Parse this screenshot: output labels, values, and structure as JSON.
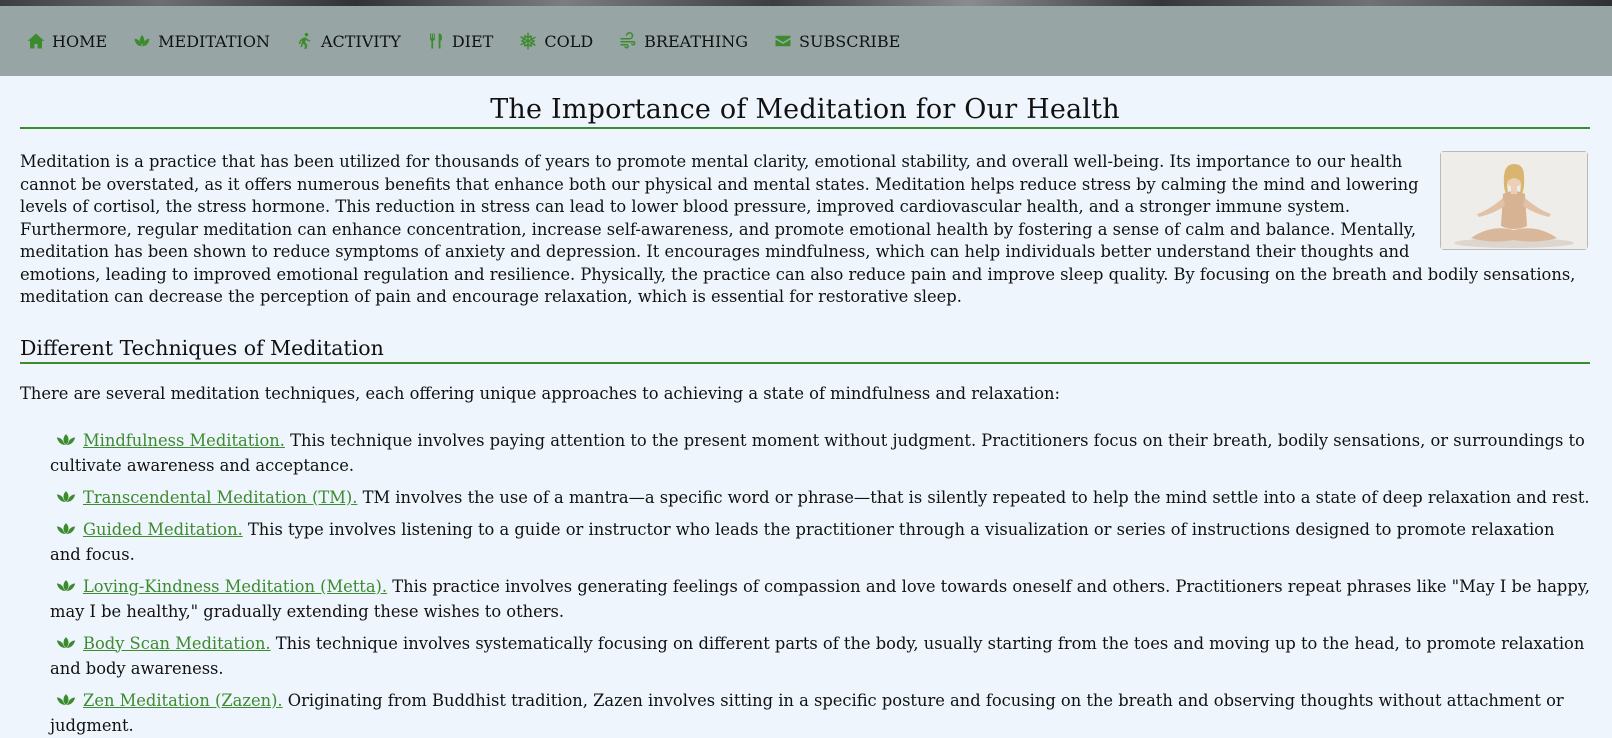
{
  "nav": {
    "items": [
      {
        "label": "HOME",
        "icon": "home-icon"
      },
      {
        "label": "MEDITATION",
        "icon": "lotus-icon"
      },
      {
        "label": "ACTIVITY",
        "icon": "running-icon"
      },
      {
        "label": "DIET",
        "icon": "utensils-icon"
      },
      {
        "label": "COLD",
        "icon": "snowflake-icon"
      },
      {
        "label": "BREATHING",
        "icon": "wind-icon"
      },
      {
        "label": "SUBSCRIBE",
        "icon": "envelope-icon"
      }
    ]
  },
  "article": {
    "title": "The Importance of Meditation for Our Health",
    "intro": "Meditation is a practice that has been utilized for thousands of years to promote mental clarity, emotional stability, and overall well-being. Its importance to our health cannot be overstated, as it offers numerous benefits that enhance both our physical and mental states. Meditation helps reduce stress by calming the mind and lowering levels of cortisol, the stress hormone. This reduction in stress can lead to lower blood pressure, improved cardiovascular health, and a stronger immune system. Furthermore, regular meditation can enhance concentration, increase self-awareness, and promote emotional health by fostering a sense of calm and balance. Mentally, meditation has been shown to reduce symptoms of anxiety and depression. It encourages mindfulness, which can help individuals better understand their thoughts and emotions, leading to improved emotional regulation and resilience. Physically, the practice can also reduce pain and improve sleep quality. By focusing on the breath and bodily sensations, meditation can decrease the perception of pain and encourage relaxation, which is essential for restorative sleep.",
    "techniques_heading": "Different Techniques of Meditation",
    "techniques_lead": "There are several meditation techniques, each offering unique approaches to achieving a state of mindfulness and relaxation:",
    "techniques": [
      {
        "name": "Mindfulness Meditation.",
        "text": " This technique involves paying attention to the present moment without judgment. Practitioners focus on their breath, bodily sensations, or surroundings to cultivate awareness and acceptance."
      },
      {
        "name": "Transcendental Meditation (TM).",
        "text": " TM involves the use of a mantra—a specific word or phrase—that is silently repeated to help the mind settle into a state of deep relaxation and rest."
      },
      {
        "name": "Guided Meditation.",
        "text": " This type involves listening to a guide or instructor who leads the practitioner through a visualization or series of instructions designed to promote relaxation and focus."
      },
      {
        "name": "Loving-Kindness Meditation (Metta).",
        "text": " This practice involves generating feelings of compassion and love towards oneself and others. Practitioners repeat phrases like \"May I be happy, may I be healthy,\" gradually extending these wishes to others."
      },
      {
        "name": "Body Scan Meditation.",
        "text": " This technique involves systematically focusing on different parts of the body, usually starting from the toes and moving up to the head, to promote relaxation and body awareness."
      },
      {
        "name": "Zen Meditation (Zazen).",
        "text": " Originating from Buddhist tradition, Zazen involves sitting in a specific posture and focusing on the breath and observing thoughts without attachment or judgment."
      }
    ]
  },
  "colors": {
    "accent": "#3d8b2f",
    "nav_bg": "#98a5a5",
    "page_bg": "#eef5fc"
  }
}
